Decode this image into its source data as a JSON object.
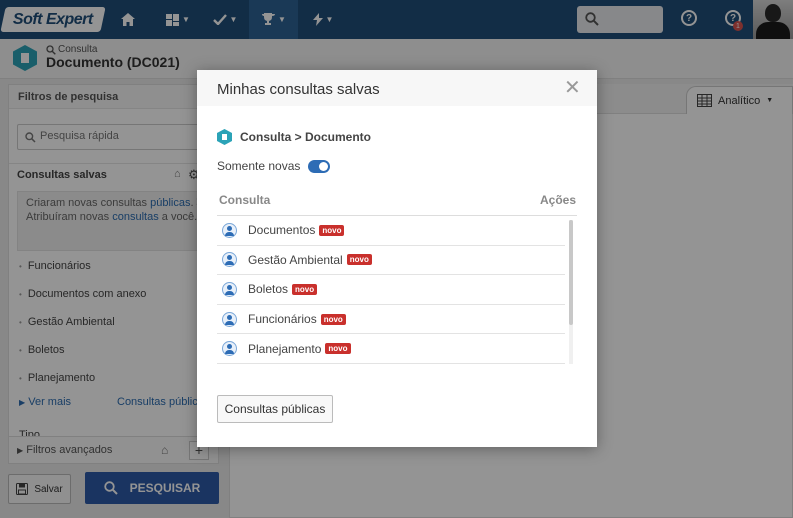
{
  "topbar": {
    "logo": "Soft Expert",
    "notification_count": "1"
  },
  "header": {
    "subtitle": "Consulta",
    "title": "Documento (DC021)"
  },
  "left_panel": {
    "title": "Filtros de pesquisa",
    "search_placeholder": "Pesquisa rápida",
    "saved_title": "Consultas salvas",
    "notice": {
      "line1": "Criaram novas consultas",
      "line1_link": "públicas",
      "line2": "Atribuíram novas",
      "line2_link": "consultas",
      "line2_suffix": "a você."
    },
    "saved_items": [
      "Funcionários",
      "Documentos com anexo",
      "Gestão Ambiental",
      "Boletos",
      "Planejamento"
    ],
    "ver_mais": "Ver mais",
    "consultas_publicas": "Consultas públicas",
    "tipo": "Tipo",
    "advanced_filters": "Filtros avançados"
  },
  "actions": {
    "save": "Salvar",
    "search": "PESQUISAR"
  },
  "right_panel": {
    "view_mode": "Analítico"
  },
  "modal": {
    "title": "Minhas consultas salvas",
    "breadcrumb": "Consulta > Documento",
    "toggle_label": "Somente novas",
    "col_consulta": "Consulta",
    "col_acoes": "Ações",
    "rows": [
      {
        "label": "Documentos",
        "badge": "novo"
      },
      {
        "label": "Gestão Ambiental",
        "badge": "novo"
      },
      {
        "label": "Boletos",
        "badge": "novo"
      },
      {
        "label": "Funcionários",
        "badge": "novo"
      },
      {
        "label": "Planejamento",
        "badge": "novo"
      }
    ],
    "public_button": "Consultas públicas"
  },
  "colors": {
    "topbar": "#1f4e79",
    "primary": "#2d5aa8",
    "badge": "#c9302c",
    "accent": "#2ba3b7"
  },
  "icons": [
    "home-icon",
    "dashboard-icon",
    "check-icon",
    "trophy-icon",
    "lightning-icon",
    "search-icon",
    "help-icon",
    "notification-icon",
    "user-icon",
    "close-icon",
    "table-icon",
    "save-icon",
    "broom-icon",
    "gear-icon",
    "plus-icon"
  ]
}
